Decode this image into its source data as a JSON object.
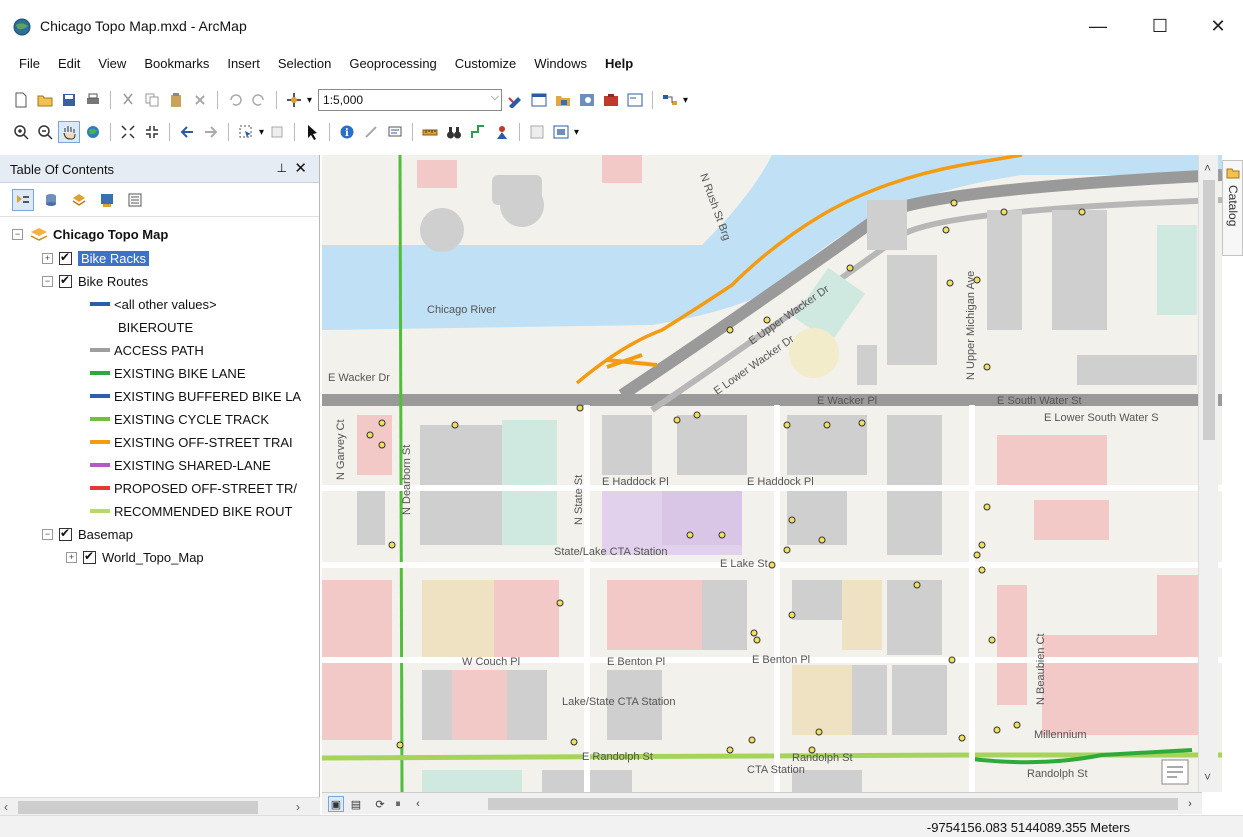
{
  "window": {
    "title": "Chicago Topo Map.mxd - ArcMap",
    "minimize": "—",
    "maximize": "☐",
    "close": "✕"
  },
  "menu": [
    "File",
    "Edit",
    "View",
    "Bookmarks",
    "Insert",
    "Selection",
    "Geoprocessing",
    "Customize",
    "Windows",
    "Help"
  ],
  "toolbar": {
    "scale_value": "1:5,000"
  },
  "toc": {
    "title": "Table Of Contents",
    "pin": "📌",
    "close": "✕",
    "data_frame": "Chicago Topo Map",
    "layers": [
      {
        "label": "Bike Racks",
        "selected": true,
        "expander": "+"
      },
      {
        "label": "Bike Routes",
        "selected": false,
        "expander": "−"
      }
    ],
    "bike_route_field": "BIKEROUTE",
    "legend": [
      {
        "label": "<all other values>",
        "color": "#2a5fa8"
      },
      {
        "label": "ACCESS PATH",
        "color": "#9e9e9e"
      },
      {
        "label": "EXISTING BIKE LANE",
        "color": "#2eaa3a"
      },
      {
        "label": "EXISTING BUFFERED BIKE LA",
        "color": "#2d5db0"
      },
      {
        "label": "EXISTING CYCLE TRACK",
        "color": "#6fc13a"
      },
      {
        "label": "EXISTING OFF-STREET TRAI",
        "color": "#f39c12"
      },
      {
        "label": "EXISTING SHARED-LANE",
        "color": "#b05cc4"
      },
      {
        "label": "PROPOSED OFF-STREET TR/",
        "color": "#e53935"
      },
      {
        "label": "RECOMMENDED BIKE ROUT",
        "color": "#b7d96a"
      }
    ],
    "basemap": "Basemap",
    "basemap_child": "World_Topo_Map"
  },
  "map": {
    "street_labels": [
      "E Wacker Dr",
      "E Wacker Pl",
      "E South Water St",
      "E Lower South Water S",
      "E Haddock Pl",
      "E Haddock Pl",
      "E Lake St",
      "W Couch Pl",
      "E Benton Pl",
      "E Benton Pl",
      "Chicago River",
      "N State St",
      "N Dearborn St",
      "N Garvey Ct",
      "N Upper Michigan Ave",
      "N Beaubien Ct",
      "State/Lake CTA Station",
      "Lake/State CTA Station",
      "E Lower Wacker Dr",
      "E Upper Wacker Dr",
      "N Rush St Brg",
      "CTA Station",
      "E Randolph St",
      "Randolph St",
      "Millennium",
      "Randolph St"
    ]
  },
  "catalog_tab": "Catalog",
  "status": {
    "coordinates": "-9754156.083  5144089.355 Meters"
  },
  "colors": {
    "selection_blue": "#3b73c7",
    "panel_header": "#e6ecf3",
    "river": "#bfe0f5",
    "wacker_road": "#9a9a9a",
    "building_gray": "#cfcfcf",
    "building_pink": "#f2c9c6",
    "building_tan": "#efe2c2",
    "building_teal": "#cfe9e1",
    "building_purple": "#e2d1ec"
  }
}
